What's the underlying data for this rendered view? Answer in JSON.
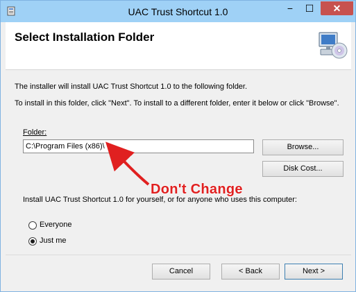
{
  "window": {
    "title": "UAC Trust Shortcut 1.0",
    "minimize_glyph": "−",
    "maximize_glyph": "☐",
    "close_glyph": "✕"
  },
  "header": {
    "title": "Select Installation Folder",
    "icon": "computer-cd-icon"
  },
  "body": {
    "intro": "The installer will install UAC Trust Shortcut 1.0 to the following folder.",
    "instructions": "To install in this folder, click \"Next\". To install to a different folder, enter it below or click \"Browse\".",
    "folder_label": "Folder:",
    "folder_value": "C:\\Program Files (x86)\\",
    "browse_label": "Browse...",
    "disk_cost_label": "Disk Cost...",
    "scope_question": "Install UAC Trust Shortcut 1.0 for yourself, or for anyone who uses this computer:",
    "options": [
      {
        "label": "Everyone",
        "selected": false
      },
      {
        "label": "Just me",
        "selected": true
      }
    ]
  },
  "annotation": {
    "text": "Don't Change",
    "color": "#e02020"
  },
  "footer": {
    "cancel_label": "Cancel",
    "back_label": "< Back",
    "next_label": "Next >"
  }
}
